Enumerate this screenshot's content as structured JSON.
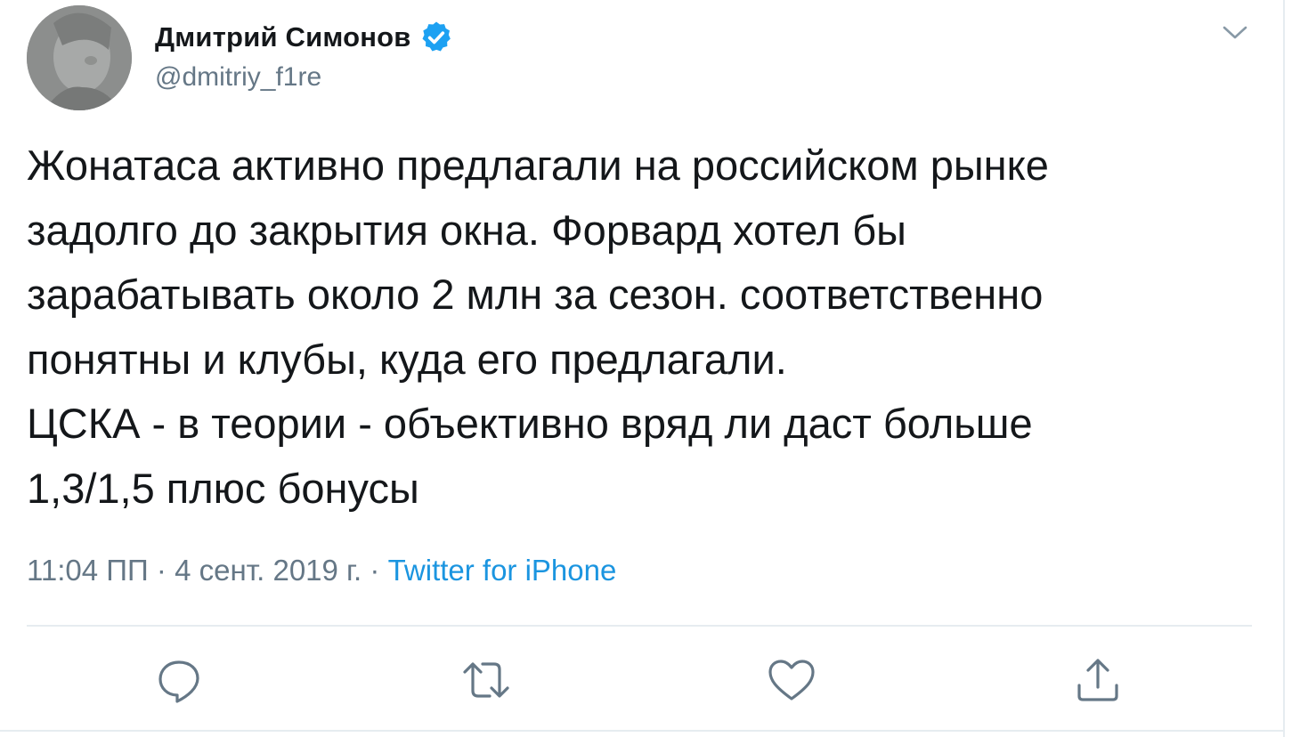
{
  "author": {
    "display_name": "Дмитрий Симонов",
    "handle": "@dmitriy_f1re",
    "verified": true
  },
  "tweet": {
    "text": "Жонатаса активно предлагали на российском рынке\nзадолго до закрытия окна. Форвард хотел бы\nзарабатывать около 2 млн за сезон. соответственно\nпонятны и клубы, куда его предлагали.\nЦСКА - в теории - объективно вряд ли даст больше\n1,3/1,5 плюс бонусы",
    "time": "11:04 ПП",
    "separator": " · ",
    "date": "4 сент. 2019 г.",
    "separator2": " · ",
    "source": "Twitter for iPhone"
  },
  "icons": {
    "verified": "verified-badge-icon",
    "more": "chevron-down-icon",
    "reply": "reply-bubble-icon",
    "retweet": "retweet-icon",
    "like": "heart-icon",
    "share": "share-upload-icon"
  },
  "colors": {
    "text": "#14171a",
    "secondary": "#657786",
    "link": "#1b95e0",
    "verified": "#1da1f2",
    "divider": "#e6ecf0"
  }
}
